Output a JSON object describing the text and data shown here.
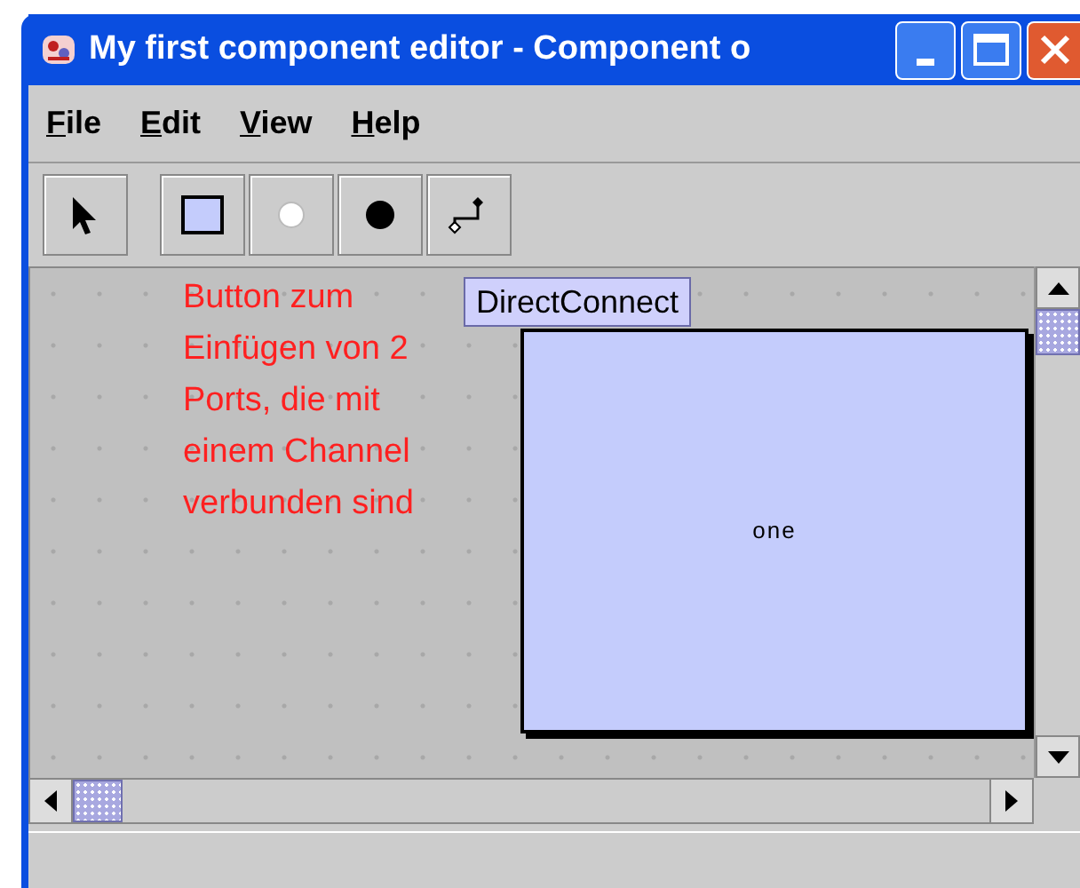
{
  "window": {
    "title": "My first component editor - Component o"
  },
  "menu": [
    {
      "label": "File"
    },
    {
      "label": "Edit"
    },
    {
      "label": "View"
    },
    {
      "label": "Help"
    }
  ],
  "toolbar": [
    {
      "kind": "pointer"
    },
    {
      "kind": "rectangle"
    },
    {
      "kind": "open-circle"
    },
    {
      "kind": "filled-circle"
    },
    {
      "kind": "connector"
    }
  ],
  "canvas": {
    "note": [
      "Button zum",
      "Einfügen von 2",
      "Ports, die mit",
      "einem Channel",
      "verbunden sind"
    ],
    "tooltip": "DirectConnect",
    "component": {
      "label": "one"
    }
  }
}
